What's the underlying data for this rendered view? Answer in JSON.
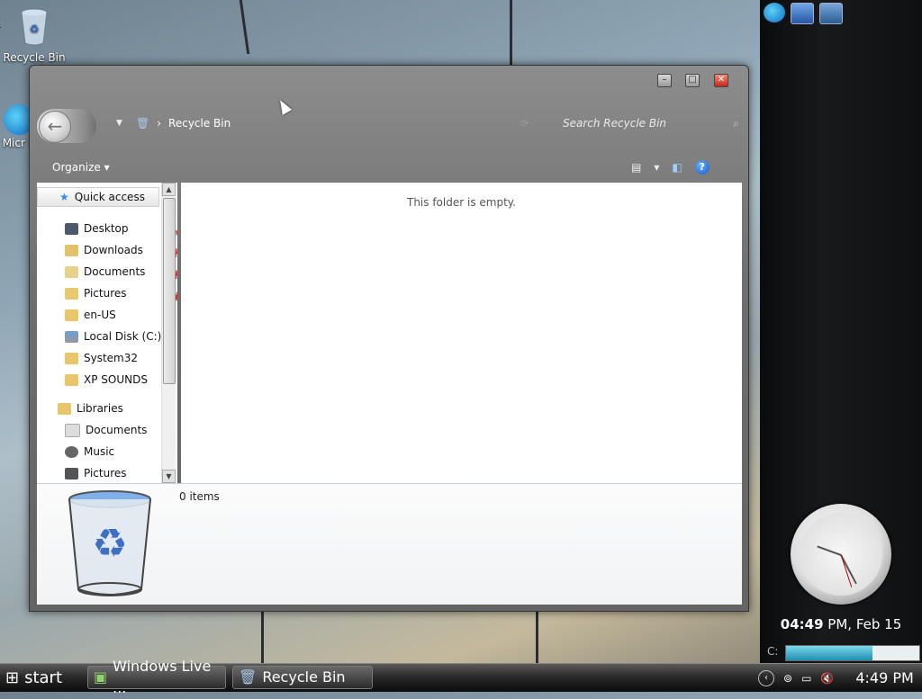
{
  "desktop": {
    "icons": [
      {
        "label": "Recycle Bin"
      },
      {
        "label": "Micr E"
      }
    ]
  },
  "window": {
    "title_buttons": {
      "minimize": "–",
      "maximize": "□",
      "close": "✕"
    },
    "breadcrumb": {
      "location": "Recycle Bin",
      "separator": "›"
    },
    "search_placeholder": "Search Recycle Bin",
    "toolbar": {
      "organize_label": "Organize"
    },
    "nav_pane": {
      "quick_access_label": "Quick access",
      "quick_access_items": [
        {
          "label": "Desktop",
          "pinned": true
        },
        {
          "label": "Downloads",
          "pinned": true
        },
        {
          "label": "Documents",
          "pinned": true
        },
        {
          "label": "Pictures",
          "pinned": true
        },
        {
          "label": "en-US",
          "pinned": false
        },
        {
          "label": "Local Disk (C:)",
          "pinned": false
        },
        {
          "label": "System32",
          "pinned": false
        },
        {
          "label": "XP SOUNDS",
          "pinned": false
        }
      ],
      "libraries_label": "Libraries",
      "libraries_items": [
        {
          "label": "Documents"
        },
        {
          "label": "Music"
        },
        {
          "label": "Pictures"
        }
      ]
    },
    "main_pane": {
      "empty_message": "This folder is empty."
    },
    "details_pane": {
      "item_count": "0 items"
    }
  },
  "sidebar": {
    "clock_time": "04:49",
    "clock_suffix": "PM, Feb 15",
    "drive_label": "C:",
    "drive_usage_fraction": 0.65
  },
  "taskbar": {
    "start_label": "start",
    "buttons": [
      {
        "label": "Windows Live ..."
      },
      {
        "label": "Recycle Bin"
      }
    ],
    "tray_time": "4:49 PM"
  },
  "colors": {
    "accent": "#1f8fb0",
    "close_button": "#c6281a",
    "help_icon": "#1357c9"
  }
}
